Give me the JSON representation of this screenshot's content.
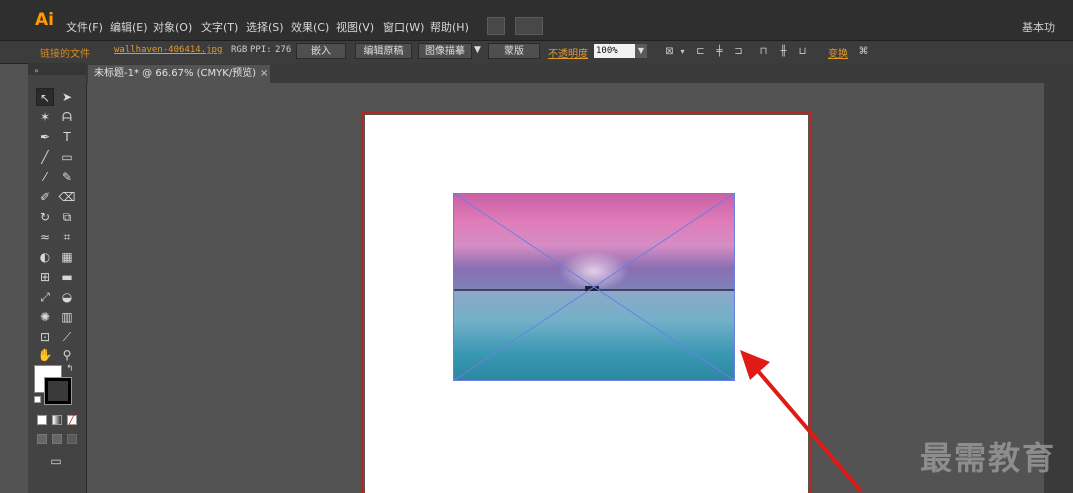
{
  "app": {
    "logo": "Ai"
  },
  "menu": [
    "文件(F)",
    "编辑(E)",
    "对象(O)",
    "文字(T)",
    "选择(S)",
    "效果(C)",
    "视图(V)",
    "窗口(W)",
    "帮助(H)"
  ],
  "workspace_label": "基本功",
  "control_panel": {
    "linked_file": "链接的文件",
    "filename": "wallhaven-406414.jpg",
    "color_mode": "RGB",
    "ppi_label": "PPI:",
    "ppi_value": "276",
    "embed_button": "嵌入",
    "edit_original_button": "编辑原稿",
    "image_trace_button": "图像描摹",
    "mask_button": "蒙版",
    "opacity_label": "不透明度",
    "opacity_value": "100%",
    "transform_label": "变换"
  },
  "document_tab": {
    "title": "未标题-1* @ 66.67% (CMYK/预览)",
    "close": "×"
  },
  "tools": {
    "panel_grip": "»",
    "swap": "↰"
  },
  "watermark": "最需教育",
  "annotation_arrow_color": "#e01a14",
  "accent_color": "#ff9a00"
}
